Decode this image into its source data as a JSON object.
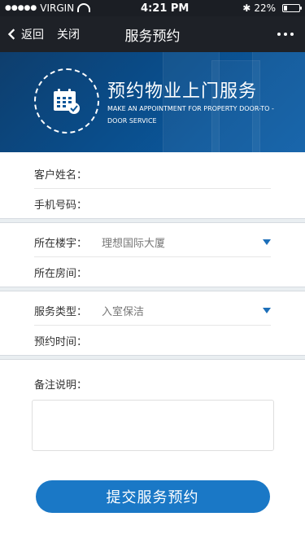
{
  "status": {
    "carrier": "VIRGIN",
    "time": "4:21 PM",
    "battery": "22%",
    "battery_level": 0.22
  },
  "nav": {
    "back_label": "返回",
    "close_label": "关闭",
    "title": "服务预约"
  },
  "banner": {
    "title": "预约物业上门服务",
    "subtitle": "MAKE AN APPOINTMENT FOR PROPERTY DOOR-TO -DOOR SERVICE"
  },
  "form": {
    "customer_name_label": "客户姓名：",
    "phone_label": "手机号码：",
    "building_label": "所在楼宇：",
    "building_value": "理想国际大厦",
    "room_label": "所在房间：",
    "service_type_label": "服务类型：",
    "service_type_value": "入室保洁",
    "appointment_time_label": "预约时间：",
    "notes_label": "备注说明："
  },
  "submit_label": "提交服务预约",
  "colors": {
    "navbar": "#1e2127",
    "accent": "#1a78c6",
    "banner": "#0b5699"
  },
  "icons": {
    "back": "chevron-left-icon",
    "more": "more-dots-icon",
    "banner_icon": "calendar-icon",
    "select": "dropdown-triangle-icon"
  }
}
